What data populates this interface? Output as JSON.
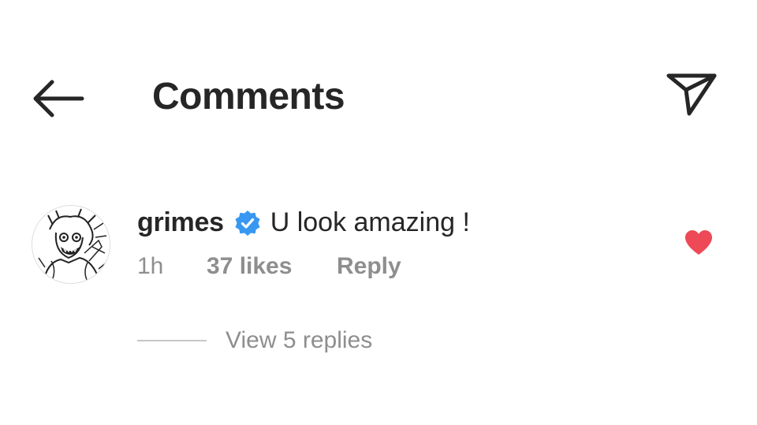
{
  "header": {
    "title": "Comments",
    "back_icon": "arrow-left-icon",
    "share_icon": "send-icon"
  },
  "comment": {
    "username": "grimes",
    "verified": true,
    "verified_color": "#3897f0",
    "text": "U look amazing !",
    "time": "1h",
    "likes": "37 likes",
    "reply_label": "Reply",
    "liked": true,
    "like_color": "#ed4956",
    "view_replies": "View 5 replies"
  },
  "colors": {
    "text_primary": "#262626",
    "text_secondary": "#8e8e8e",
    "divider": "#c7c7c7"
  }
}
